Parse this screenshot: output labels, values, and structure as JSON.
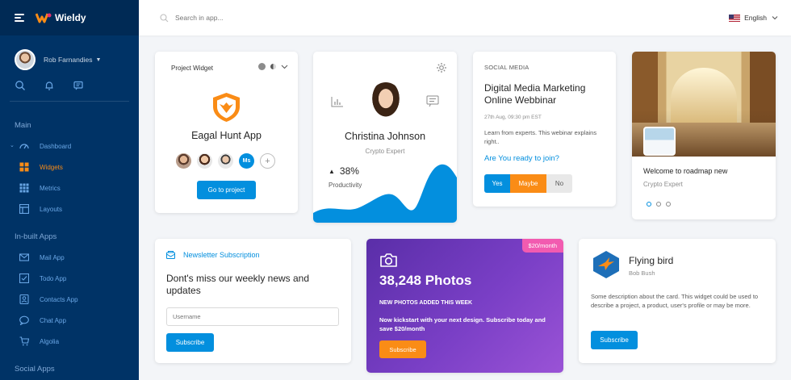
{
  "app": {
    "brand": "Wieldy"
  },
  "sidebar": {
    "user_name": "Rob Farnandies",
    "sections": {
      "main": "Main",
      "inbuilt": "In-built Apps",
      "social": "Social Apps"
    },
    "main_items": [
      {
        "label": "Dashboard",
        "icon": "dashboard-icon"
      },
      {
        "label": "Widgets",
        "icon": "widgets-icon",
        "active": true
      },
      {
        "label": "Metrics",
        "icon": "metrics-icon"
      },
      {
        "label": "Layouts",
        "icon": "layouts-icon"
      }
    ],
    "app_items": [
      {
        "label": "Mail App",
        "icon": "mail-icon"
      },
      {
        "label": "Todo App",
        "icon": "todo-icon"
      },
      {
        "label": "Contacts App",
        "icon": "contacts-icon"
      },
      {
        "label": "Chat App",
        "icon": "chat-icon"
      },
      {
        "label": "Algolia",
        "icon": "cart-icon"
      }
    ]
  },
  "topbar": {
    "search_placeholder": "Search in app...",
    "language": "English"
  },
  "project_widget": {
    "title": "Project Widget",
    "name": "Eagal Hunt App",
    "member_initials": "Ms",
    "button": "Go to project"
  },
  "profile_card": {
    "name": "Christina Johnson",
    "role": "Crypto Expert",
    "percent": "38%",
    "metric_label": "Productivity"
  },
  "social_card": {
    "tag": "SOCIAL MEDIA",
    "title": "Digital Media Marketing Online Webbinar",
    "date": "27th Aug, 09:30 pm EST",
    "desc": "Learn from experts. This webinar explains right..",
    "question": "Are You ready to join?",
    "yes": "Yes",
    "maybe": "Maybe",
    "no": "No"
  },
  "roadmap_card": {
    "title": "Welcome to roadmap new",
    "subtitle": "Crypto Expert"
  },
  "newsletter": {
    "header": "Newsletter Subscription",
    "title": "Dont's miss our weekly news and updates",
    "placeholder": "Username",
    "button": "Subscribe"
  },
  "photos_card": {
    "badge": "$20/month",
    "count": "38,248 Photos",
    "subtitle": "NEW PHOTOS ADDED THIS WEEK",
    "desc": "Now kickstart with your next design. Subscribe today and save $20/month",
    "button": "Subscribe"
  },
  "bird_card": {
    "name": "Flying bird",
    "author": "Bob Bush",
    "desc": "Some description about the card. This widget could be used to describe a project, a product, user's profile or may be more.",
    "button": "Subscribe"
  },
  "colors": {
    "primary": "#038fde",
    "accent": "#fa8c16",
    "sidebar": "#003366",
    "badge": "#f25bb0"
  }
}
